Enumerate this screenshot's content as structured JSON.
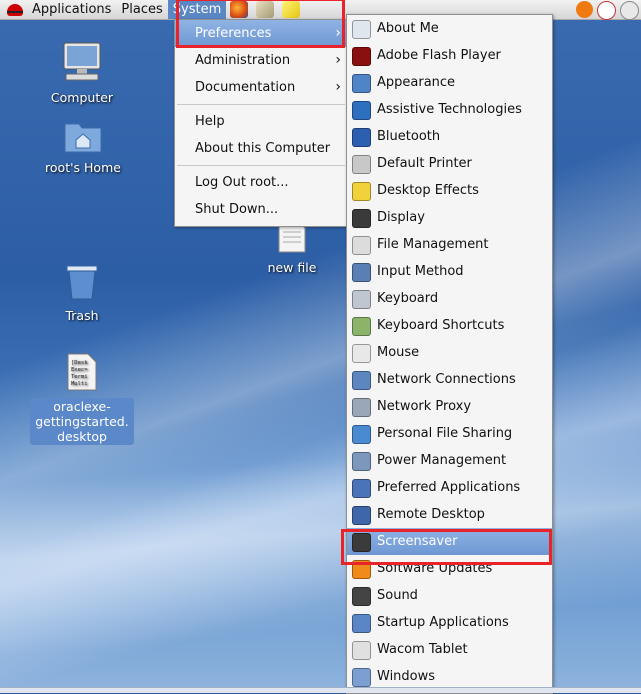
{
  "panel": {
    "applications": "Applications",
    "places": "Places",
    "system": "System"
  },
  "system_menu": {
    "preferences": "Preferences",
    "administration": "Administration",
    "documentation": "Documentation",
    "help": "Help",
    "about": "About this Computer",
    "logout": "Log Out root...",
    "shutdown": "Shut Down..."
  },
  "desktop": {
    "computer": "Computer",
    "home": "root's Home",
    "trash": "Trash",
    "oraclexe_1": "oraclexe-",
    "oraclexe_2": "gettingstarted.",
    "oraclexe_3": "desktop",
    "new_file": "new file"
  },
  "preferences_submenu": [
    {
      "label": "About Me",
      "icon": "about-me-icon",
      "color": "#dfe6ee"
    },
    {
      "label": "Adobe Flash Player",
      "icon": "flash-icon",
      "color": "#8a0f0f"
    },
    {
      "label": "Appearance",
      "icon": "appearance-icon",
      "color": "#4f84c8"
    },
    {
      "label": "Assistive Technologies",
      "icon": "accessibility-icon",
      "color": "#2f6fc0"
    },
    {
      "label": "Bluetooth",
      "icon": "bluetooth-icon",
      "color": "#2c5fb0"
    },
    {
      "label": "Default Printer",
      "icon": "printer-icon",
      "color": "#c8c8c8"
    },
    {
      "label": "Desktop Effects",
      "icon": "desktop-effects-icon",
      "color": "#f2d23a"
    },
    {
      "label": "Display",
      "icon": "display-icon",
      "color": "#3a3a3a"
    },
    {
      "label": "File Management",
      "icon": "file-management-icon",
      "color": "#dcdcdc"
    },
    {
      "label": "Input Method",
      "icon": "input-method-icon",
      "color": "#5a7fb5"
    },
    {
      "label": "Keyboard",
      "icon": "keyboard-icon",
      "color": "#bfc6cf"
    },
    {
      "label": "Keyboard Shortcuts",
      "icon": "keyboard-shortcuts-icon",
      "color": "#8bb36a"
    },
    {
      "label": "Mouse",
      "icon": "mouse-icon",
      "color": "#e8e8e8"
    },
    {
      "label": "Network Connections",
      "icon": "network-connections-icon",
      "color": "#5d86c0"
    },
    {
      "label": "Network Proxy",
      "icon": "network-proxy-icon",
      "color": "#9aa7b8"
    },
    {
      "label": "Personal File Sharing",
      "icon": "file-sharing-icon",
      "color": "#4a8ad0"
    },
    {
      "label": "Power Management",
      "icon": "power-management-icon",
      "color": "#7c96bc"
    },
    {
      "label": "Preferred Applications",
      "icon": "preferred-apps-icon",
      "color": "#4b73b8"
    },
    {
      "label": "Remote Desktop",
      "icon": "remote-desktop-icon",
      "color": "#3e66a8"
    },
    {
      "label": "Screensaver",
      "icon": "screensaver-icon",
      "color": "#3b3b3b",
      "selected": true
    },
    {
      "label": "Software Updates",
      "icon": "software-updates-icon",
      "color": "#f08a1a"
    },
    {
      "label": "Sound",
      "icon": "sound-icon",
      "color": "#444444"
    },
    {
      "label": "Startup Applications",
      "icon": "startup-apps-icon",
      "color": "#5a86c6"
    },
    {
      "label": "Wacom Tablet",
      "icon": "wacom-tablet-icon",
      "color": "#e0e0e0"
    },
    {
      "label": "Windows",
      "icon": "windows-icon",
      "color": "#7a9fd0"
    }
  ]
}
